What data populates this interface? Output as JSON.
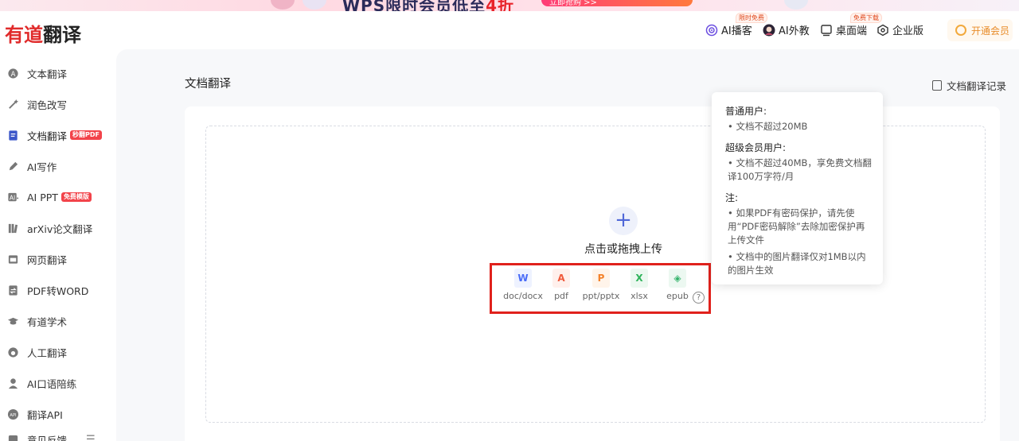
{
  "banner": {
    "headline_main": "WPS限时会员低至",
    "headline_accent": "4折",
    "pill_text": "立即抢购 >>"
  },
  "header": {
    "logo_red": "有道",
    "logo_dark": "翻译",
    "nav": [
      {
        "label": "AI播客",
        "badge": "限时免费"
      },
      {
        "label": "AI外教",
        "badge": ""
      },
      {
        "label": "桌面端",
        "badge": "免费下载"
      },
      {
        "label": "企业版",
        "badge": ""
      }
    ],
    "vip_label": "开通会员"
  },
  "sidebar": {
    "items": [
      {
        "label": "文本翻译",
        "tag": "",
        "icon": "text-translate-icon"
      },
      {
        "label": "润色改写",
        "tag": "",
        "icon": "magic-wand-icon"
      },
      {
        "label": "文档翻译",
        "tag": "秒翻PDF",
        "icon": "document-icon"
      },
      {
        "label": "AI写作",
        "tag": "",
        "icon": "pen-icon"
      },
      {
        "label": "AI PPT",
        "tag": "免费模版",
        "icon": "ppt-icon"
      },
      {
        "label": "arXiv论文翻译",
        "tag": "",
        "icon": "books-icon"
      },
      {
        "label": "网页翻译",
        "tag": "",
        "icon": "webpage-icon"
      },
      {
        "label": "PDF转WORD",
        "tag": "",
        "icon": "convert-icon"
      },
      {
        "label": "有道学术",
        "tag": "",
        "icon": "graduation-cap-icon"
      },
      {
        "label": "人工翻译",
        "tag": "",
        "icon": "headset-icon"
      },
      {
        "label": "AI口语陪练",
        "tag": "",
        "icon": "person-icon"
      },
      {
        "label": "翻译API",
        "tag": "",
        "icon": "api-icon"
      },
      {
        "label": "意见反馈",
        "tag": "",
        "icon": "feedback-icon"
      }
    ]
  },
  "main": {
    "title": "文档翻译",
    "history_label": "文档翻译记录",
    "upload_text": "点击或拖拽上传",
    "plus": "+",
    "formats": [
      {
        "label": "doc/docx",
        "glyph": "W",
        "color": "#4a6cf7"
      },
      {
        "label": "pdf",
        "glyph": "A",
        "color": "#f05a3c"
      },
      {
        "label": "ppt/pptx",
        "glyph": "P",
        "color": "#f4822a"
      },
      {
        "label": "xlsx",
        "glyph": "X",
        "color": "#2fb35b"
      },
      {
        "label": "epub",
        "glyph": "◈",
        "color": "#35b36b"
      }
    ],
    "help": "?"
  },
  "tooltip": {
    "normal_title": "普通用户:",
    "normal_1": "• 文档不超过20MB",
    "super_title": "超级会员用户:",
    "super_1": "• 文档不超过40MB，享免费文档翻译100万字符/月",
    "note_title": "注:",
    "note_1": "• 如果PDF有密码保护，请先使用“PDF密码解除”去除加密保护再上传文件",
    "note_2": "• 文档中的图片翻译仅对1MB以内的图片生效"
  }
}
